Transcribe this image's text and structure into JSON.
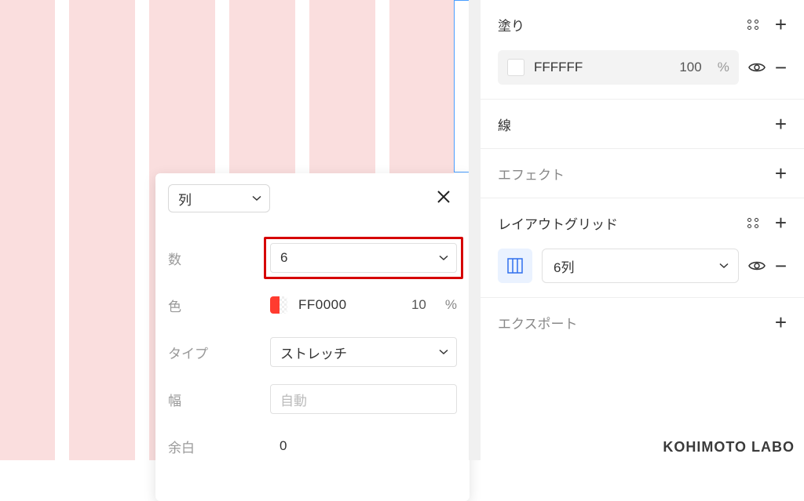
{
  "popup": {
    "layout_type": "列",
    "count_label": "数",
    "count_value": "6",
    "color_label": "色",
    "color_hex": "FF0000",
    "color_opacity": "10",
    "pct": "%",
    "type_label": "タイプ",
    "type_value": "ストレッチ",
    "width_label": "幅",
    "width_placeholder": "自動",
    "gutter_label": "余白",
    "gutter_value": "0"
  },
  "panel": {
    "fill_title": "塗り",
    "fill_hex": "FFFFFF",
    "fill_opacity": "100",
    "pct": "%",
    "stroke_title": "線",
    "effects_title": "エフェクト",
    "grid_title": "レイアウトグリッド",
    "grid_value": "6列",
    "export_title": "エクスポート"
  },
  "watermark": "KOHIMOTO LABO"
}
